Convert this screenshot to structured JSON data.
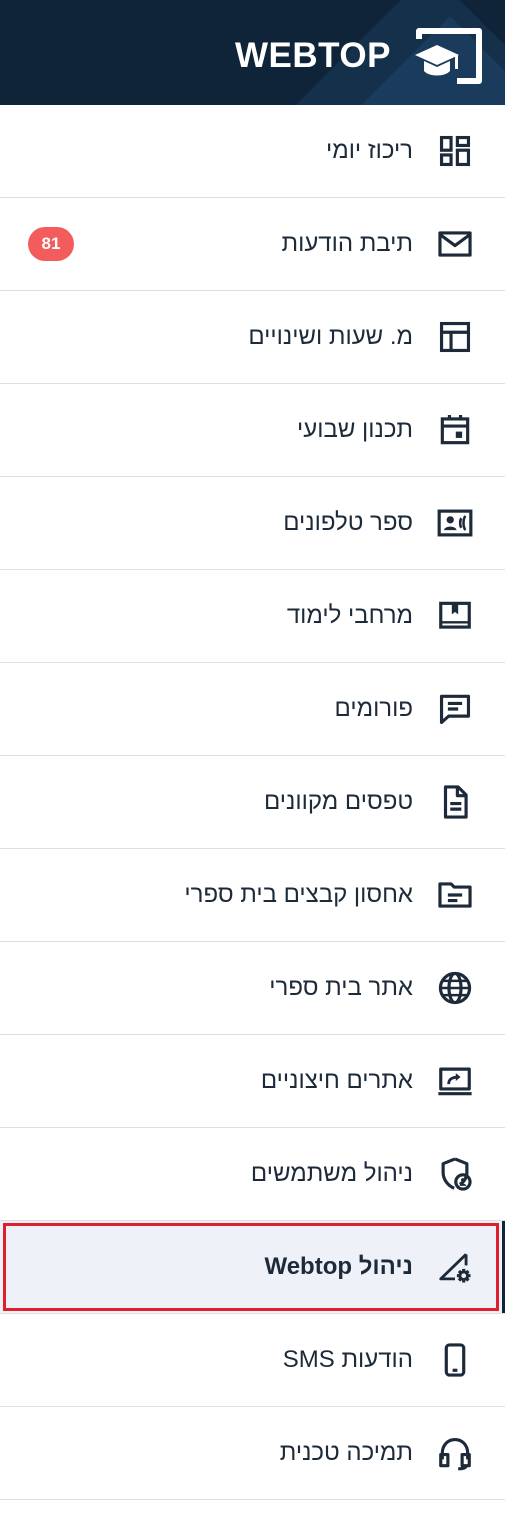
{
  "header": {
    "title": "WEBTOP",
    "logo_icon": "monitor-graduation-cap-icon",
    "background_color": "#0f2438"
  },
  "accent_colors": {
    "badge": "#f25c5c",
    "active_outline": "#e01f2e",
    "active_background": "#eef2f8"
  },
  "menu": {
    "items": [
      {
        "label": "ריכוז יומי",
        "icon": "dashboard-icon"
      },
      {
        "label": "תיבת הודעות",
        "icon": "mail-icon",
        "badge": "81"
      },
      {
        "label": "מ. שעות ושינויים",
        "icon": "timetable-icon"
      },
      {
        "label": "תכנון שבועי",
        "icon": "calendar-icon"
      },
      {
        "label": "ספר טלפונים",
        "icon": "contact-card-icon"
      },
      {
        "label": "מרחבי לימוד",
        "icon": "bookmark-book-icon"
      },
      {
        "label": "פורומים",
        "icon": "chat-icon"
      },
      {
        "label": "טפסים מקוונים",
        "icon": "document-icon"
      },
      {
        "label": "אחסון קבצים בית ספרי",
        "icon": "folder-icon"
      },
      {
        "label": "אתר בית ספרי",
        "icon": "globe-icon"
      },
      {
        "label": "אתרים חיצוניים",
        "icon": "screen-share-icon"
      },
      {
        "label": "ניהול משתמשים",
        "icon": "shield-user-icon"
      },
      {
        "label": "ניהול Webtop",
        "icon": "settings-triangle-icon",
        "active": true
      },
      {
        "label": "הודעות SMS",
        "icon": "mobile-phone-icon"
      },
      {
        "label": "תמיכה טכנית",
        "icon": "headset-icon"
      }
    ]
  }
}
